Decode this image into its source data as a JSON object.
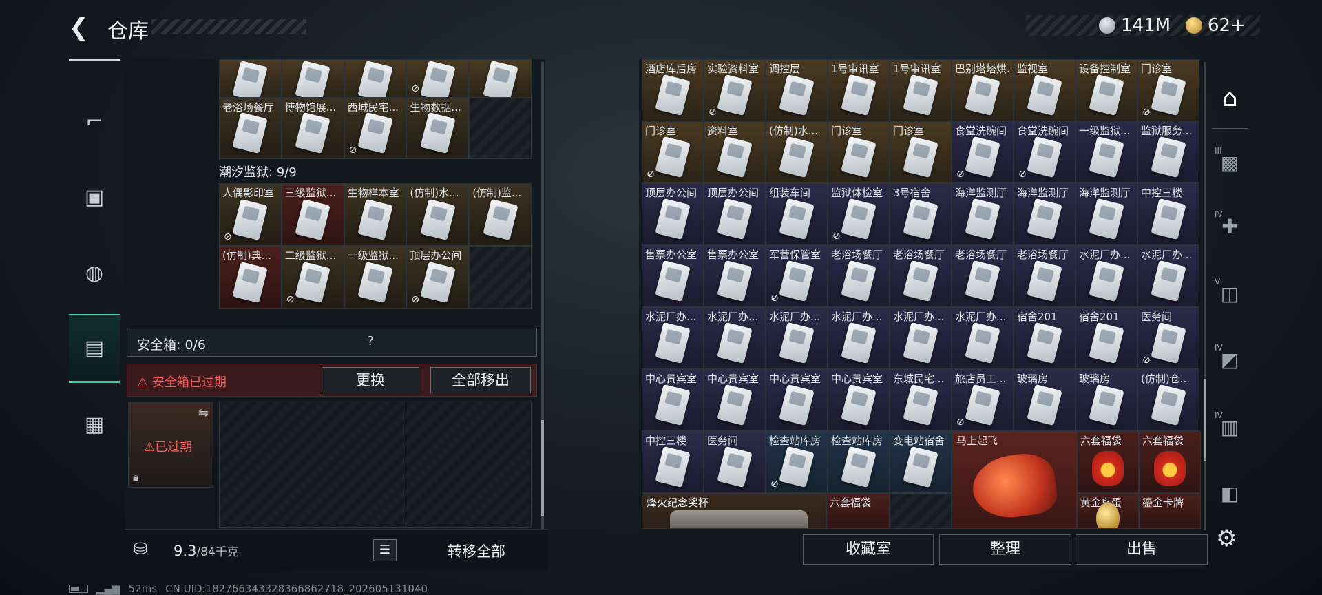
{
  "header": {
    "back_icon": "back-arrow-icon",
    "title": "仓库",
    "currency_silver": "141M",
    "currency_gold": "62+"
  },
  "left_nav": {
    "items": [
      {
        "name": "nav-weapons",
        "icon": "gun-icon",
        "glyph": "⌐"
      },
      {
        "name": "nav-armor",
        "icon": "armor-icon",
        "glyph": "▣"
      },
      {
        "name": "nav-backpack",
        "icon": "backpack-icon",
        "glyph": "◍"
      },
      {
        "name": "nav-safebox",
        "icon": "safebox-icon",
        "glyph": "▤"
      },
      {
        "name": "nav-toolbox",
        "icon": "toolbox-icon",
        "glyph": "▦"
      }
    ],
    "active_index": 3
  },
  "left_panel": {
    "top_grid": [
      {
        "label": "",
        "color": "gold",
        "nofav": false
      },
      {
        "label": "",
        "color": "gold",
        "nofav": false
      },
      {
        "label": "",
        "color": "gold",
        "nofav": false
      },
      {
        "label": "",
        "color": "gold",
        "nofav": true
      },
      {
        "label": "",
        "color": "gold",
        "nofav": false
      },
      {
        "label": "老浴场餐厅",
        "color": "dgold",
        "nofav": false
      },
      {
        "label": "博物馆展...",
        "color": "dgold",
        "nofav": false
      },
      {
        "label": "西城民宅...",
        "color": "dgold",
        "nofav": true
      },
      {
        "label": "生物数据...",
        "color": "dgold",
        "nofav": false
      },
      {
        "label": "",
        "color": "empty",
        "nofav": false
      }
    ],
    "section_title": "潮汐监狱: 9/9",
    "prison_grid": [
      {
        "label": "人偶影印室",
        "color": "dgold",
        "nofav": true
      },
      {
        "label": "三级监狱...",
        "color": "red",
        "nofav": false
      },
      {
        "label": "生物样本室",
        "color": "dgold",
        "nofav": false
      },
      {
        "label": "(仿制)水...",
        "color": "dgold",
        "nofav": false
      },
      {
        "label": "(仿制)监...",
        "color": "dgold",
        "nofav": false
      },
      {
        "label": "(仿制)典...",
        "color": "red",
        "nofav": false
      },
      {
        "label": "二级监狱...",
        "color": "dgold",
        "nofav": true
      },
      {
        "label": "一级监狱...",
        "color": "dgold",
        "nofav": false
      },
      {
        "label": "顶层办公间",
        "color": "dgold",
        "nofav": true
      },
      {
        "label": "",
        "color": "empty",
        "nofav": false
      }
    ],
    "safebox_label": "安全箱: 0/6",
    "safebox_help": "?",
    "expired_warning": "⚠ 安全箱已过期",
    "replace_button": "更换",
    "remove_all_button": "全部移出",
    "slot_expired": "⚠已过期",
    "weight_current": "9.3",
    "weight_max": "/84千克",
    "transfer_all": "转移全部"
  },
  "status": {
    "ping": "52ms",
    "uid": "CN UID:182766343328366862718_202605131040"
  },
  "right_panel": {
    "grid": [
      {
        "label": "酒店库后房",
        "color": "gold",
        "nofav": false
      },
      {
        "label": "实验资料室",
        "color": "gold",
        "nofav": true
      },
      {
        "label": "调控层",
        "color": "gold",
        "nofav": false
      },
      {
        "label": "1号审讯室",
        "color": "gold",
        "nofav": false
      },
      {
        "label": "1号审讯室",
        "color": "gold",
        "nofav": false
      },
      {
        "label": "巴别塔塔烘...",
        "color": "gold",
        "nofav": false
      },
      {
        "label": "监视室",
        "color": "gold",
        "nofav": false
      },
      {
        "label": "设备控制室",
        "color": "gold",
        "nofav": false
      },
      {
        "label": "门诊室",
        "color": "gold",
        "nofav": true
      },
      {
        "label": "门诊室",
        "color": "gold",
        "nofav": true
      },
      {
        "label": "资料室",
        "color": "gold",
        "nofav": false
      },
      {
        "label": "(仿制)水...",
        "color": "gold",
        "nofav": false
      },
      {
        "label": "门诊室",
        "color": "gold",
        "nofav": false
      },
      {
        "label": "门诊室",
        "color": "gold",
        "nofav": false
      },
      {
        "label": "食堂洗碗间",
        "color": "purple",
        "nofav": true
      },
      {
        "label": "食堂洗碗间",
        "color": "purple",
        "nofav": true
      },
      {
        "label": "一级监狱...",
        "color": "purple",
        "nofav": false
      },
      {
        "label": "监狱服务...",
        "color": "purple",
        "nofav": false
      },
      {
        "label": "顶层办公间",
        "color": "purple",
        "nofav": false
      },
      {
        "label": "顶层办公间",
        "color": "purple",
        "nofav": false
      },
      {
        "label": "组装车间",
        "color": "purple",
        "nofav": false
      },
      {
        "label": "监狱体检室",
        "color": "purple",
        "nofav": true
      },
      {
        "label": "3号宿舍",
        "color": "purple",
        "nofav": false
      },
      {
        "label": "海洋监测厅",
        "color": "purple",
        "nofav": false
      },
      {
        "label": "海洋监测厅",
        "color": "purple",
        "nofav": false
      },
      {
        "label": "海洋监测厅",
        "color": "purple",
        "nofav": false
      },
      {
        "label": "中控三楼",
        "color": "purple",
        "nofav": false
      },
      {
        "label": "售票办公室",
        "color": "purple",
        "nofav": false
      },
      {
        "label": "售票办公室",
        "color": "purple",
        "nofav": false
      },
      {
        "label": "军营保管室",
        "color": "purple",
        "nofav": true
      },
      {
        "label": "老浴场餐厅",
        "color": "purple",
        "nofav": false
      },
      {
        "label": "老浴场餐厅",
        "color": "purple",
        "nofav": false
      },
      {
        "label": "老浴场餐厅",
        "color": "purple",
        "nofav": false
      },
      {
        "label": "老浴场餐厅",
        "color": "purple",
        "nofav": false
      },
      {
        "label": "水泥厂办...",
        "color": "purple",
        "nofav": false
      },
      {
        "label": "水泥厂办...",
        "color": "purple",
        "nofav": false
      },
      {
        "label": "水泥厂办...",
        "color": "purple",
        "nofav": false
      },
      {
        "label": "水泥厂办...",
        "color": "purple",
        "nofav": false
      },
      {
        "label": "水泥厂办...",
        "color": "purple",
        "nofav": false
      },
      {
        "label": "水泥厂办...",
        "color": "purple",
        "nofav": false
      },
      {
        "label": "水泥厂办...",
        "color": "purple",
        "nofav": false
      },
      {
        "label": "水泥厂办...",
        "color": "purple",
        "nofav": false
      },
      {
        "label": "宿舍201",
        "color": "purple",
        "nofav": false
      },
      {
        "label": "宿舍201",
        "color": "purple",
        "nofav": false
      },
      {
        "label": "医务间",
        "color": "purple",
        "nofav": true
      },
      {
        "label": "中心贵宾室",
        "color": "purple",
        "nofav": false
      },
      {
        "label": "中心贵宾室",
        "color": "purple",
        "nofav": false
      },
      {
        "label": "中心贵宾室",
        "color": "purple",
        "nofav": false
      },
      {
        "label": "中心贵宾室",
        "color": "purple",
        "nofav": false
      },
      {
        "label": "东城民宅...",
        "color": "purple",
        "nofav": false
      },
      {
        "label": "旅店员工...",
        "color": "purple",
        "nofav": true
      },
      {
        "label": "玻璃房",
        "color": "purple",
        "nofav": false
      },
      {
        "label": "玻璃房",
        "color": "purple",
        "nofav": false
      },
      {
        "label": "(仿制)仓...",
        "color": "purple",
        "nofav": false
      },
      {
        "label": "中控三楼",
        "color": "purple",
        "nofav": false
      },
      {
        "label": "医务间",
        "color": "purple",
        "nofav": false
      },
      {
        "label": "检查站库房",
        "color": "blue",
        "nofav": true
      },
      {
        "label": "检查站库房",
        "color": "blue",
        "nofav": false
      },
      {
        "label": "变电站宿舍",
        "color": "blue",
        "nofav": false
      }
    ],
    "horse_label": "马上起飞",
    "bag1_label": "六套福袋",
    "bag2_label": "六套福袋",
    "trophy_label": "烽火纪念奖杯",
    "bag3_label": "六套福袋",
    "egg_label": "黄金鸟蛋",
    "card_label": "鎏金卡牌",
    "collection_button": "收藏室",
    "sort_button": "整理",
    "sell_button": "出售"
  },
  "right_nav": {
    "items": [
      {
        "name": "rnav-all",
        "icon": "all-items-icon",
        "glyph": "⌂",
        "tier": ""
      },
      {
        "name": "rnav-tier3",
        "icon": "tier3-icon",
        "glyph": "▩",
        "tier": "III"
      },
      {
        "name": "rnav-tier4a",
        "icon": "tier4-medical-icon",
        "glyph": "✚",
        "tier": "IV"
      },
      {
        "name": "rnav-tier5",
        "icon": "tier5-icon",
        "glyph": "◫",
        "tier": "V"
      },
      {
        "name": "rnav-tier4b",
        "icon": "tier4-key-icon",
        "glyph": "◩",
        "tier": "IV"
      },
      {
        "name": "rnav-tier4c",
        "icon": "tier4-folder-icon",
        "glyph": "▥",
        "tier": "IV"
      },
      {
        "name": "rnav-tier-misc",
        "icon": "misc-icon",
        "glyph": "◧",
        "tier": ""
      }
    ]
  }
}
